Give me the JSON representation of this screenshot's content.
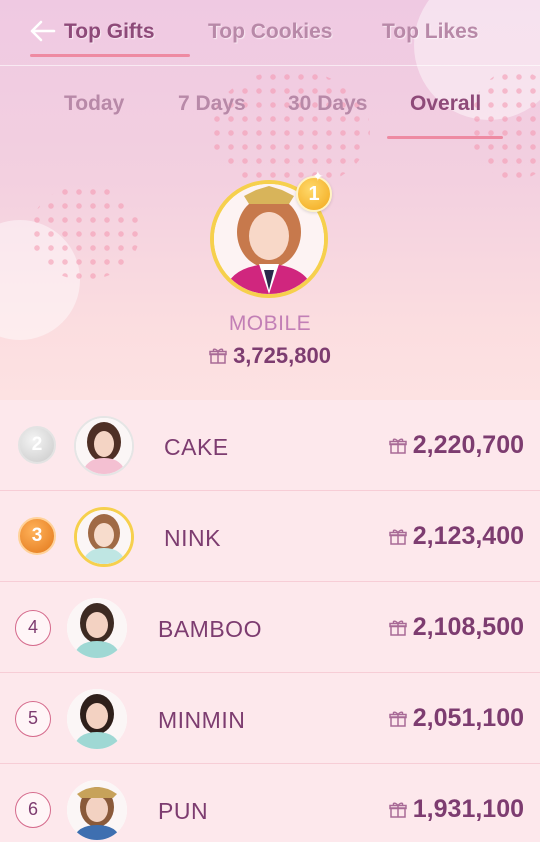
{
  "tabs": [
    {
      "label": "Top Gifts",
      "active": true
    },
    {
      "label": "Top Cookies",
      "active": false
    },
    {
      "label": "Top Likes",
      "active": false
    }
  ],
  "periods": [
    {
      "label": "Today",
      "active": false
    },
    {
      "label": "7 Days",
      "active": false
    },
    {
      "label": "30 Days",
      "active": false
    },
    {
      "label": "Overall",
      "active": true
    }
  ],
  "winner": {
    "rank": "1",
    "name": "MOBILE",
    "score": "3,725,800"
  },
  "ranking": [
    {
      "rank": "2",
      "name": "CAKE",
      "score": "2,220,700"
    },
    {
      "rank": "3",
      "name": "NINK",
      "score": "2,123,400"
    },
    {
      "rank": "4",
      "name": "BAMBOO",
      "score": "2,108,500"
    },
    {
      "rank": "5",
      "name": "MINMIN",
      "score": "2,051,100"
    },
    {
      "rank": "6",
      "name": "PUN",
      "score": "1,931,100"
    }
  ],
  "colors": {
    "accent": "#ee8aa2",
    "text": "#7d3c70",
    "gold": "#f6d04d"
  }
}
